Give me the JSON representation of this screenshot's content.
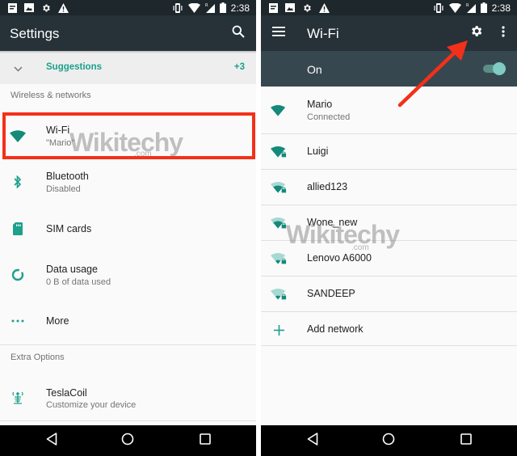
{
  "status_bar": {
    "time": "2:38",
    "left_icons": [
      "notification-icon",
      "image-icon",
      "settings-icon",
      "warning-icon"
    ],
    "right_icons": [
      "vibrate-icon",
      "wifi-icon",
      "signal-roaming-icon",
      "battery-icon"
    ]
  },
  "left_screen": {
    "title": "Settings",
    "search_icon": "search-icon",
    "suggestions": {
      "label": "Suggestions",
      "count": "+3"
    },
    "sections": [
      {
        "header": "Wireless & networks",
        "items": [
          {
            "icon": "wifi-icon",
            "title": "Wi-Fi",
            "subtitle": "\"Mario\""
          },
          {
            "icon": "bluetooth-icon",
            "title": "Bluetooth",
            "subtitle": "Disabled"
          },
          {
            "icon": "sim-card-icon",
            "title": "SIM cards",
            "subtitle": ""
          },
          {
            "icon": "data-usage-icon",
            "title": "Data usage",
            "subtitle": "0 B of data used"
          },
          {
            "icon": "more-icon",
            "title": "More",
            "subtitle": ""
          }
        ]
      },
      {
        "header": "Extra Options",
        "items": [
          {
            "icon": "teslacoil-icon",
            "title": "TeslaCoil",
            "subtitle": "Customize your device"
          }
        ]
      }
    ]
  },
  "right_screen": {
    "title": "Wi-Fi",
    "wifi_switch": {
      "label": "On",
      "enabled": true
    },
    "networks": [
      {
        "name": "Mario",
        "status": "Connected",
        "signal": "full",
        "locked": false
      },
      {
        "name": "Luigi",
        "status": "",
        "signal": "full",
        "locked": true
      },
      {
        "name": "allied123",
        "status": "",
        "signal": "medium",
        "locked": true
      },
      {
        "name": "Wone_new",
        "status": "",
        "signal": "medium",
        "locked": true
      },
      {
        "name": "Lenovo A6000",
        "status": "",
        "signal": "low",
        "locked": true
      },
      {
        "name": "SANDEEP",
        "status": "",
        "signal": "low",
        "locked": true
      }
    ],
    "add_network": "Add network"
  },
  "watermark": {
    "text": "Wikitechy",
    "sub": ".com"
  },
  "colors": {
    "accent": "#1da08c",
    "appbar": "#263238",
    "statusbar": "#1e272c",
    "switch_bar": "#37474f",
    "highlight": "#f3301a",
    "arrow": "#f3301a"
  }
}
